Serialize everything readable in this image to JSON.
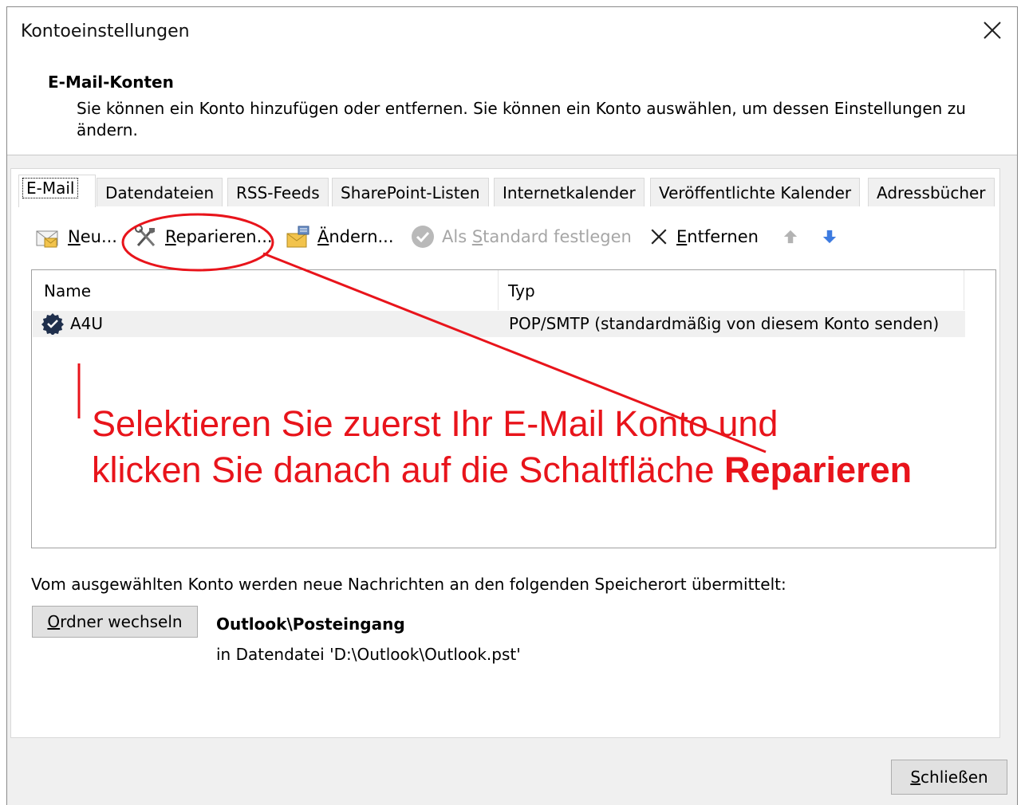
{
  "window": {
    "title": "Kontoeinstellungen",
    "close_label": "×"
  },
  "header": {
    "section_title": "E-Mail-Konten",
    "description": "Sie können ein Konto hinzufügen oder entfernen. Sie können ein Konto auswählen, um dessen Einstellungen zu ändern."
  },
  "tabs": [
    {
      "label": "E-Mail",
      "active": true
    },
    {
      "label": "Datendateien"
    },
    {
      "label": "RSS-Feeds"
    },
    {
      "label": "SharePoint-Listen"
    },
    {
      "label": "Internetkalender"
    },
    {
      "label": "Veröffentlichte Kalender"
    },
    {
      "label": "Adressbücher"
    }
  ],
  "toolbar": {
    "new": {
      "first": "N",
      "rest": "eu...",
      "icon": "new-mail-icon"
    },
    "repair": {
      "first": "R",
      "rest": "eparieren...",
      "icon": "tools-icon"
    },
    "change": {
      "first": "Ä",
      "rest": "ndern...",
      "icon": "change-settings-icon"
    },
    "set_default": {
      "pre": "Als ",
      "first": "S",
      "rest": "tandard festlegen",
      "icon": "check-circle-icon",
      "enabled": false
    },
    "remove": {
      "first": "E",
      "rest": "ntfernen",
      "icon": "x-icon"
    },
    "move_up_icon": "arrow-up-icon",
    "move_down_icon": "arrow-down-icon"
  },
  "accounts_list": {
    "columns": [
      "Name",
      "Typ"
    ],
    "rows": [
      {
        "name": "A4U",
        "type": "POP/SMTP (standardmäßig von diesem Konto senden)",
        "default": true
      }
    ]
  },
  "annotation": {
    "line1": "Selektieren Sie zuerst Ihr E-Mail Konto und",
    "line2_pre": "klicken Sie danach auf die Schaltfläche ",
    "line2_bold": "Reparieren",
    "color": "#e8141b"
  },
  "delivery": {
    "text": "Vom ausgewählten Konto werden neue Nachrichten an den folgenden Speicherort übermittelt:",
    "change_folder_first": "O",
    "change_folder_rest": "rdner wechseln",
    "folder": "Outlook\\Posteingang",
    "data_file": "in Datendatei 'D:\\Outlook\\Outlook.pst'"
  },
  "footer": {
    "close_first": "S",
    "close_rest": "chließen"
  }
}
